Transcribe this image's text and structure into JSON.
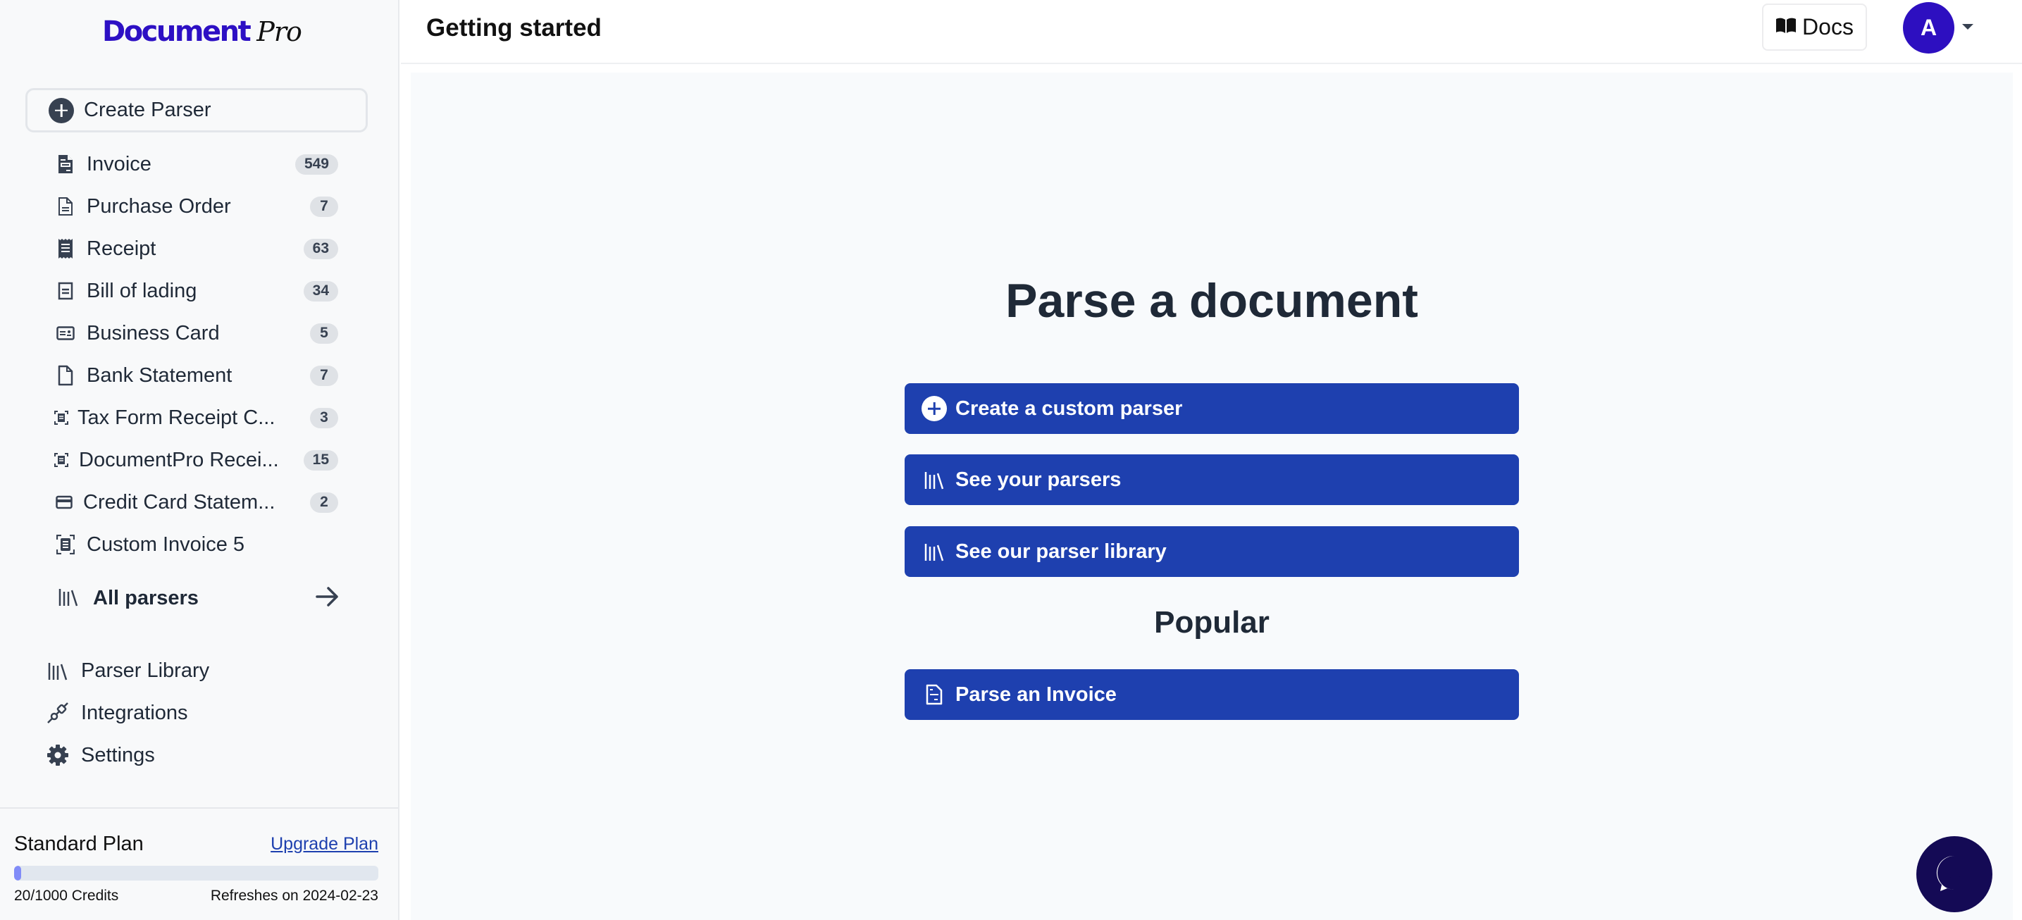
{
  "brand": {
    "name_main": "Document",
    "name_suffix": "Pro",
    "color": "#2d10c4"
  },
  "sidebar": {
    "create_parser_label": "Create Parser",
    "parsers": [
      {
        "label": "Invoice",
        "count": "549",
        "icon": "invoice-icon"
      },
      {
        "label": "Purchase Order",
        "count": "7",
        "icon": "document-lines-icon"
      },
      {
        "label": "Receipt",
        "count": "63",
        "icon": "receipt-icon"
      },
      {
        "label": "Bill of lading",
        "count": "34",
        "icon": "bill-icon"
      },
      {
        "label": "Business Card",
        "count": "5",
        "icon": "contact-card-icon"
      },
      {
        "label": "Bank Statement",
        "count": "7",
        "icon": "blank-document-icon"
      },
      {
        "label": "Tax Form Receipt C...",
        "count": "3",
        "icon": "document-scan-icon"
      },
      {
        "label": "DocumentPro Recei...",
        "count": "15",
        "icon": "document-scan-icon"
      },
      {
        "label": "Credit Card Statem...",
        "count": "2",
        "icon": "credit-card-icon"
      },
      {
        "label": "Custom Invoice 5",
        "count": null,
        "icon": "document-scan-icon"
      }
    ],
    "all_parsers_label": "All parsers",
    "nav": [
      {
        "label": "Parser Library",
        "icon": "library-icon"
      },
      {
        "label": "Integrations",
        "icon": "plug-icon"
      },
      {
        "label": "Settings",
        "icon": "gear-icon"
      }
    ],
    "plan": {
      "name": "Standard Plan",
      "upgrade_label": "Upgrade Plan",
      "credits_used": 20,
      "credits_total": 1000,
      "credits_text": "20/1000 Credits",
      "refresh_text": "Refreshes on 2024-02-23",
      "progress_fraction": 0.02
    }
  },
  "header": {
    "title": "Getting started",
    "docs_label": "Docs",
    "avatar_initial": "A",
    "avatar_color": "#2d0fc0"
  },
  "main": {
    "title": "Parse a document",
    "actions": [
      {
        "label": "Create a custom parser",
        "icon": "plus-circle-icon"
      },
      {
        "label": "See your parsers",
        "icon": "library-icon"
      },
      {
        "label": "See our parser library",
        "icon": "library-icon"
      }
    ],
    "popular_title": "Popular",
    "popular": [
      {
        "label": "Parse an Invoice",
        "icon": "invoice-icon"
      }
    ],
    "button_color": "#1e40af"
  },
  "chat": {
    "icon": "chat-bubble-icon",
    "color": "#140a55"
  }
}
